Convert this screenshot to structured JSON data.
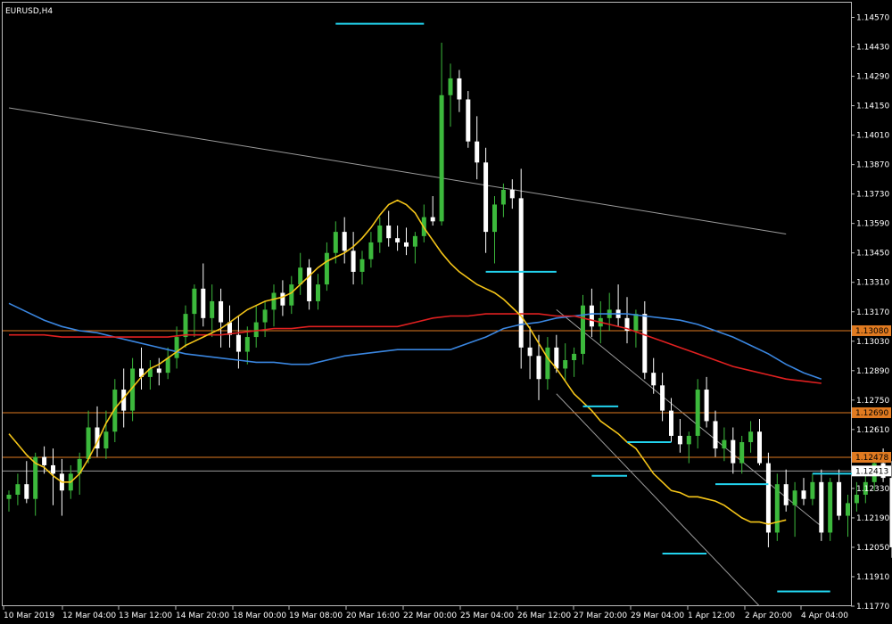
{
  "chart_data": {
    "type": "candlestick",
    "title": "EURUSD,H4",
    "symbol": "EURUSD",
    "timeframe": "H4",
    "ylim": [
      1.1177,
      1.1464
    ],
    "y_ticks": [
      "1.14570",
      "1.14430",
      "1.14290",
      "1.14150",
      "1.14010",
      "1.13870",
      "1.13730",
      "1.13590",
      "1.13450",
      "1.13310",
      "1.13170",
      "1.13030",
      "1.12890",
      "1.12750",
      "1.12610",
      "1.12470",
      "1.12330",
      "1.12190",
      "1.12050",
      "1.11910",
      "1.11770"
    ],
    "x_ticks": [
      "10 Mar 2019",
      "12 Mar 04:00",
      "13 Mar 12:00",
      "14 Mar 20:00",
      "18 Mar 00:00",
      "19 Mar 08:00",
      "20 Mar 16:00",
      "22 Mar 00:00",
      "25 Mar 04:00",
      "26 Mar 12:00",
      "27 Mar 20:00",
      "29 Mar 04:00",
      "1 Apr 12:00",
      "2 Apr 20:00",
      "4 Apr 04:00"
    ],
    "grid": false,
    "colors": {
      "background": "#000000",
      "bull": "#3cb93c",
      "bear": "#ffffff",
      "ma_fast": "#f5c518",
      "ma_mid": "#e02020",
      "ma_slow": "#3a86e0",
      "hline": "#e07a20",
      "trendline": "#9a9a9a",
      "marker": "#22d3ee"
    },
    "candles": [
      [
        1.1228,
        1.1232,
        1.1222,
        1.123
      ],
      [
        1.123,
        1.124,
        1.1225,
        1.1235
      ],
      [
        1.1235,
        1.1246,
        1.1226,
        1.1228
      ],
      [
        1.1228,
        1.125,
        1.122,
        1.1248
      ],
      [
        1.1248,
        1.1253,
        1.124,
        1.1244
      ],
      [
        1.1244,
        1.1252,
        1.1225,
        1.124
      ],
      [
        1.124,
        1.1247,
        1.122,
        1.1232
      ],
      [
        1.1232,
        1.1244,
        1.1228,
        1.124
      ],
      [
        1.124,
        1.125,
        1.123,
        1.1247
      ],
      [
        1.1247,
        1.127,
        1.1245,
        1.1262
      ],
      [
        1.1262,
        1.1272,
        1.1248,
        1.1252
      ],
      [
        1.1252,
        1.127,
        1.1247,
        1.126
      ],
      [
        1.126,
        1.1285,
        1.1255,
        1.128
      ],
      [
        1.128,
        1.129,
        1.1262,
        1.127
      ],
      [
        1.127,
        1.1295,
        1.1265,
        1.129
      ],
      [
        1.129,
        1.13,
        1.128,
        1.1286
      ],
      [
        1.1286,
        1.1294,
        1.128,
        1.129
      ],
      [
        1.129,
        1.1295,
        1.1282,
        1.1288
      ],
      [
        1.1288,
        1.13,
        1.1285,
        1.1295
      ],
      [
        1.1295,
        1.131,
        1.129,
        1.1305
      ],
      [
        1.1305,
        1.132,
        1.13,
        1.1316
      ],
      [
        1.1316,
        1.133,
        1.1305,
        1.1328
      ],
      [
        1.1328,
        1.134,
        1.131,
        1.1314
      ],
      [
        1.1314,
        1.133,
        1.1305,
        1.1322
      ],
      [
        1.1322,
        1.1328,
        1.13,
        1.1312
      ],
      [
        1.1312,
        1.132,
        1.13,
        1.1306
      ],
      [
        1.1306,
        1.1315,
        1.129,
        1.1298
      ],
      [
        1.1298,
        1.131,
        1.1292,
        1.1305
      ],
      [
        1.1305,
        1.132,
        1.13,
        1.1312
      ],
      [
        1.1312,
        1.1322,
        1.1305,
        1.1318
      ],
      [
        1.1318,
        1.133,
        1.131,
        1.1326
      ],
      [
        1.1326,
        1.1332,
        1.1315,
        1.132
      ],
      [
        1.132,
        1.1334,
        1.1316,
        1.133
      ],
      [
        1.133,
        1.1345,
        1.1325,
        1.1338
      ],
      [
        1.1338,
        1.1342,
        1.1318,
        1.1322
      ],
      [
        1.1322,
        1.1335,
        1.1318,
        1.133
      ],
      [
        1.133,
        1.135,
        1.1327,
        1.1345
      ],
      [
        1.1345,
        1.136,
        1.134,
        1.1355
      ],
      [
        1.1355,
        1.1362,
        1.134,
        1.1346
      ],
      [
        1.1346,
        1.1355,
        1.133,
        1.1336
      ],
      [
        1.1336,
        1.1346,
        1.133,
        1.1342
      ],
      [
        1.1342,
        1.1355,
        1.1338,
        1.135
      ],
      [
        1.135,
        1.1362,
        1.1345,
        1.1358
      ],
      [
        1.1358,
        1.1365,
        1.1348,
        1.1352
      ],
      [
        1.1352,
        1.1358,
        1.1346,
        1.135
      ],
      [
        1.135,
        1.1357,
        1.1344,
        1.1348
      ],
      [
        1.1348,
        1.1355,
        1.134,
        1.1353
      ],
      [
        1.1353,
        1.1368,
        1.135,
        1.1362
      ],
      [
        1.1362,
        1.1372,
        1.1358,
        1.136
      ],
      [
        1.136,
        1.1445,
        1.1358,
        1.142
      ],
      [
        1.142,
        1.1435,
        1.1405,
        1.1428
      ],
      [
        1.1428,
        1.1432,
        1.1412,
        1.1418
      ],
      [
        1.1418,
        1.1422,
        1.1395,
        1.1398
      ],
      [
        1.1398,
        1.141,
        1.138,
        1.1388
      ],
      [
        1.1388,
        1.1395,
        1.1345,
        1.1355
      ],
      [
        1.1355,
        1.1372,
        1.134,
        1.1368
      ],
      [
        1.1368,
        1.1378,
        1.1362,
        1.1375
      ],
      [
        1.1375,
        1.138,
        1.1366,
        1.1371
      ],
      [
        1.1371,
        1.1385,
        1.129,
        1.13
      ],
      [
        1.13,
        1.131,
        1.1285,
        1.1296
      ],
      [
        1.1296,
        1.1306,
        1.1275,
        1.1285
      ],
      [
        1.1285,
        1.1305,
        1.128,
        1.13
      ],
      [
        1.13,
        1.1306,
        1.1288,
        1.129
      ],
      [
        1.129,
        1.1302,
        1.1284,
        1.1294
      ],
      [
        1.1294,
        1.13,
        1.1286,
        1.1297
      ],
      [
        1.1297,
        1.1325,
        1.1292,
        1.132
      ],
      [
        1.132,
        1.1328,
        1.1305,
        1.131
      ],
      [
        1.131,
        1.1322,
        1.1302,
        1.1314
      ],
      [
        1.1314,
        1.1326,
        1.1308,
        1.1318
      ],
      [
        1.1318,
        1.133,
        1.131,
        1.1314
      ],
      [
        1.1314,
        1.1324,
        1.1302,
        1.1308
      ],
      [
        1.1308,
        1.1318,
        1.13,
        1.1316
      ],
      [
        1.1316,
        1.1322,
        1.1285,
        1.1288
      ],
      [
        1.1288,
        1.1295,
        1.1278,
        1.1282
      ],
      [
        1.1282,
        1.1288,
        1.1265,
        1.127
      ],
      [
        1.127,
        1.1276,
        1.1255,
        1.1258
      ],
      [
        1.1258,
        1.1266,
        1.125,
        1.1254
      ],
      [
        1.1254,
        1.126,
        1.1245,
        1.1258
      ],
      [
        1.1258,
        1.1285,
        1.1252,
        1.128
      ],
      [
        1.128,
        1.1286,
        1.1262,
        1.1265
      ],
      [
        1.1265,
        1.127,
        1.1248,
        1.1252
      ],
      [
        1.1252,
        1.1262,
        1.1246,
        1.1256
      ],
      [
        1.1256,
        1.1262,
        1.124,
        1.1245
      ],
      [
        1.1245,
        1.1258,
        1.124,
        1.1255
      ],
      [
        1.1255,
        1.1265,
        1.125,
        1.126
      ],
      [
        1.126,
        1.1266,
        1.1244,
        1.1245
      ],
      [
        1.1245,
        1.125,
        1.1205,
        1.1212
      ],
      [
        1.1212,
        1.124,
        1.1208,
        1.1235
      ],
      [
        1.1235,
        1.1242,
        1.1222,
        1.1225
      ],
      [
        1.1225,
        1.1236,
        1.121,
        1.1232
      ],
      [
        1.1232,
        1.1238,
        1.1225,
        1.1228
      ],
      [
        1.1228,
        1.124,
        1.1225,
        1.1236
      ],
      [
        1.1236,
        1.1242,
        1.1208,
        1.1212
      ],
      [
        1.1212,
        1.1238,
        1.1208,
        1.1236
      ],
      [
        1.1236,
        1.1242,
        1.1218,
        1.122
      ],
      [
        1.122,
        1.123,
        1.121,
        1.1226
      ],
      [
        1.1226,
        1.1236,
        1.1222,
        1.123
      ],
      [
        1.123,
        1.124,
        1.1226,
        1.1236
      ],
      [
        1.1236,
        1.1248,
        1.1232,
        1.1245
      ],
      [
        1.1245,
        1.1252,
        1.1236,
        1.1238
      ],
      [
        1.1238,
        1.1246,
        1.12,
        1.1205
      ],
      [
        1.1205,
        1.1214,
        1.1198,
        1.121
      ],
      [
        1.121,
        1.1215,
        1.1195,
        1.1198
      ],
      [
        1.1198,
        1.1206,
        1.119,
        1.1202
      ],
      [
        1.1202,
        1.1208,
        1.119,
        1.1193
      ],
      [
        1.1193,
        1.1212,
        1.1188,
        1.1205
      ],
      [
        1.1205,
        1.121,
        1.1185,
        1.1195
      ],
      [
        1.1195,
        1.1218,
        1.1192,
        1.1216
      ],
      [
        1.1216,
        1.1228,
        1.1212,
        1.122
      ],
      [
        1.122,
        1.1235,
        1.1218,
        1.1232
      ],
      [
        1.1232,
        1.1248,
        1.123,
        1.1245
      ],
      [
        1.1245,
        1.1252,
        1.123,
        1.1234
      ],
      [
        1.1234,
        1.1248,
        1.123,
        1.1244
      ],
      [
        1.1244,
        1.125,
        1.1232,
        1.1236
      ],
      [
        1.1236,
        1.1246,
        1.1232,
        1.1241
      ]
    ],
    "ma_fast": [
      1.1259,
      1.1254,
      1.1249,
      1.1245,
      1.1243,
      1.1239,
      1.1236,
      1.1236,
      1.124,
      1.1247,
      1.1255,
      1.1264,
      1.1271,
      1.1276,
      1.1281,
      1.1286,
      1.129,
      1.1292,
      1.1295,
      1.1298,
      1.1301,
      1.1303,
      1.1305,
      1.1307,
      1.1309,
      1.1312,
      1.1315,
      1.1318,
      1.132,
      1.1322,
      1.1323,
      1.1324,
      1.1326,
      1.133,
      1.1334,
      1.1338,
      1.1341,
      1.1343,
      1.1345,
      1.1348,
      1.1352,
      1.1357,
      1.1363,
      1.1368,
      1.137,
      1.1368,
      1.1364,
      1.1357,
      1.1351,
      1.1345,
      1.134,
      1.1336,
      1.1333,
      1.133,
      1.1328,
      1.1326,
      1.1323,
      1.1319,
      1.1315,
      1.1309,
      1.1302,
      1.1295,
      1.129,
      1.1284,
      1.1278,
      1.1274,
      1.127,
      1.1265,
      1.1262,
      1.1259,
      1.1255,
      1.1252,
      1.1246,
      1.124,
      1.1236,
      1.1232,
      1.1231,
      1.1229,
      1.1229,
      1.1228,
      1.1227,
      1.1225,
      1.1222,
      1.1219,
      1.1217,
      1.1217,
      1.1216,
      1.1217,
      1.1218
    ],
    "ma_mid": [
      1.1306,
      1.1306,
      1.1306,
      1.1305,
      1.1305,
      1.1305,
      1.1305,
      1.1305,
      1.1305,
      1.1305,
      1.1306,
      1.1306,
      1.1306,
      1.1307,
      1.1308,
      1.1309,
      1.1309,
      1.131,
      1.131,
      1.131,
      1.131,
      1.131,
      1.131,
      1.1312,
      1.1314,
      1.1315,
      1.1315,
      1.1316,
      1.1316,
      1.1316,
      1.1316,
      1.1315,
      1.1315,
      1.1313,
      1.1311,
      1.1309,
      1.1306,
      1.1303,
      1.13,
      1.1297,
      1.1294,
      1.1291,
      1.1289,
      1.1287,
      1.1285,
      1.1284,
      1.1283
    ],
    "ma_slow": [
      1.1321,
      1.1317,
      1.1313,
      1.131,
      1.1308,
      1.1307,
      1.1305,
      1.1303,
      1.1301,
      1.1299,
      1.1297,
      1.1296,
      1.1295,
      1.1294,
      1.1293,
      1.1293,
      1.1292,
      1.1292,
      1.1294,
      1.1296,
      1.1297,
      1.1298,
      1.1299,
      1.1299,
      1.1299,
      1.1299,
      1.1302,
      1.1305,
      1.1309,
      1.1311,
      1.1312,
      1.1314,
      1.1315,
      1.1316,
      1.1316,
      1.1316,
      1.1315,
      1.1314,
      1.1313,
      1.1311,
      1.1308,
      1.1305,
      1.1301,
      1.1297,
      1.1292,
      1.1288,
      1.1285
    ],
    "horizontal_levels": [
      {
        "price": 1.1308,
        "label": "1.13080"
      },
      {
        "price": 1.1269,
        "label": "1.12690"
      },
      {
        "price": 1.12478,
        "label": "1.12478"
      }
    ],
    "current_price": {
      "price": 1.12413,
      "label": "1.12413"
    },
    "trendlines": [
      {
        "from": [
          0,
          1.1414
        ],
        "to": [
          88,
          1.1354
        ]
      },
      {
        "from": [
          62,
          1.1278
        ],
        "to": [
          85,
          1.1177
        ]
      },
      {
        "from": [
          62,
          1.1318
        ],
        "to": [
          92,
          1.1215
        ]
      }
    ],
    "markers": [
      {
        "i0": 37,
        "i1": 47,
        "price": 1.1454
      },
      {
        "i0": 54,
        "i1": 62,
        "price": 1.1336
      },
      {
        "i0": 65,
        "i1": 69,
        "price": 1.1272
      },
      {
        "i0": 66,
        "i1": 70,
        "price": 1.1239
      },
      {
        "i0": 70,
        "i1": 75,
        "price": 1.1255
      },
      {
        "i0": 74,
        "i1": 79,
        "price": 1.1202
      },
      {
        "i0": 80,
        "i1": 86,
        "price": 1.1235
      },
      {
        "i0": 91,
        "i1": 97,
        "price": 1.124
      },
      {
        "i0": 87,
        "i1": 93,
        "price": 1.1184
      }
    ]
  }
}
